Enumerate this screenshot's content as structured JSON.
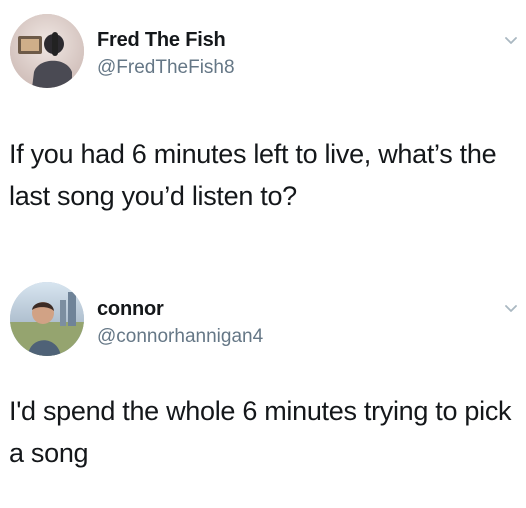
{
  "tweets": [
    {
      "display_name": "Fred The Fish",
      "handle": "@FredTheFish8",
      "text": "If you had 6 minutes left to live, what’s the last song you’d listen to?"
    },
    {
      "display_name": "connor",
      "handle": "@connorhannigan4",
      "text": "I'd spend the whole 6 minutes trying to pick a song"
    }
  ],
  "colors": {
    "text": "#14171a",
    "handle": "#657786",
    "background": "#ffffff"
  },
  "icons": {
    "avatar_1": "profile-photo-avatar",
    "avatar_2": "profile-photo-avatar",
    "chevron": "chevron-down-icon"
  }
}
